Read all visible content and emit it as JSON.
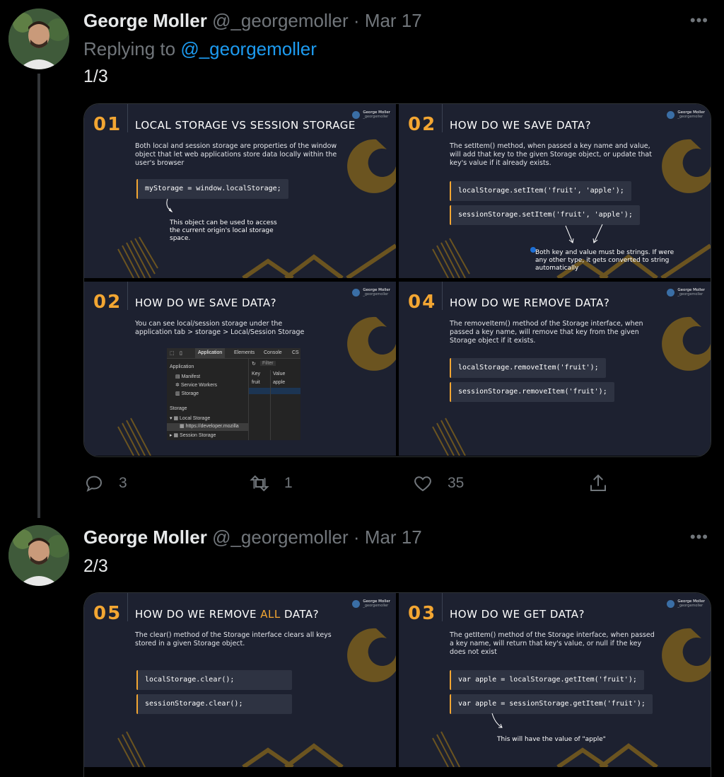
{
  "tweets": [
    {
      "author": {
        "name": "George Moller",
        "handle": "@_georgemoller",
        "date": "Mar 17"
      },
      "reply_prefix": "Replying to",
      "reply_to": "@_georgemoller",
      "text": "1/3",
      "slides": [
        {
          "num": "01",
          "title": "LOCAL STORAGE VS SESSION STORAGE",
          "desc": "Both local and session storage are properties of the window object that let web applications store data locally within the user's browser",
          "code": [
            "myStorage = window.localStorage;"
          ],
          "note": "This object can be used to access the current origin's local storage space."
        },
        {
          "num": "02",
          "title": "HOW DO WE SAVE DATA?",
          "desc": "The setItem() method, when passed a key name and value, will add that key to the given Storage object, or update that key's value if it already exists.",
          "code": [
            "localStorage.setItem('fruit', 'apple');",
            "sessionStorage.setItem('fruit', 'apple');"
          ],
          "note": "Both key and value must be strings. If were any other type, it gets converted to string automatically"
        },
        {
          "num": "02",
          "title": "HOW DO WE SAVE DATA?",
          "desc": "You can see local/session storage under the application tab > storage > Local/Session Storage",
          "devtools": {
            "tabs": [
              "Application",
              "Elements",
              "Console",
              "CS"
            ],
            "section_application": "Application",
            "items_app": [
              "Manifest",
              "Service Workers",
              "Storage"
            ],
            "section_storage": "Storage",
            "local_storage": "Local Storage",
            "origin": "https://developer.mozilla",
            "session_storage": "Session Storage",
            "filter_placeholder": "Filter",
            "col_key": "Key",
            "col_value": "Value",
            "row_key": "fruit",
            "row_value": "apple"
          }
        },
        {
          "num": "04",
          "title": "HOW DO WE REMOVE DATA?",
          "desc": "The removeItem() method of the Storage interface, when passed a key name, will remove that key from the given Storage object if it exists.",
          "code": [
            "localStorage.removeItem('fruit');",
            "sessionStorage.removeItem('fruit');"
          ]
        }
      ],
      "stats": {
        "replies": "3",
        "retweets": "1",
        "likes": "35"
      }
    },
    {
      "author": {
        "name": "George Moller",
        "handle": "@_georgemoller",
        "date": "Mar 17"
      },
      "text": "2/3",
      "slides": [
        {
          "num": "05",
          "title_pre": "HOW DO WE REMOVE ",
          "title_hl": "ALL",
          "title_post": " DATA?",
          "desc": "The clear() method of the Storage interface clears all keys stored in a given Storage object.",
          "code": [
            "localStorage.clear();",
            "sessionStorage.clear();"
          ]
        },
        {
          "num": "03",
          "title": "HOW DO WE GET DATA?",
          "desc": "The getItem() method of the Storage interface, when passed a key name, will return that key's value, or null if the key does not exist",
          "code": [
            "var apple = localStorage.getItem('fruit');",
            "var apple = sessionStorage.getItem('fruit');"
          ],
          "note": "This will have the value of \"apple\""
        }
      ]
    }
  ],
  "brand": {
    "name": "George Moller",
    "handle": "_georgemoller"
  },
  "icons": [
    "more-icon",
    "reply-icon",
    "retweet-icon",
    "like-icon",
    "share-icon"
  ],
  "colors": {
    "accent": "#f3a632",
    "link": "#1d9bf0",
    "muted": "#71767b",
    "slide_bg": "#1d2130"
  }
}
